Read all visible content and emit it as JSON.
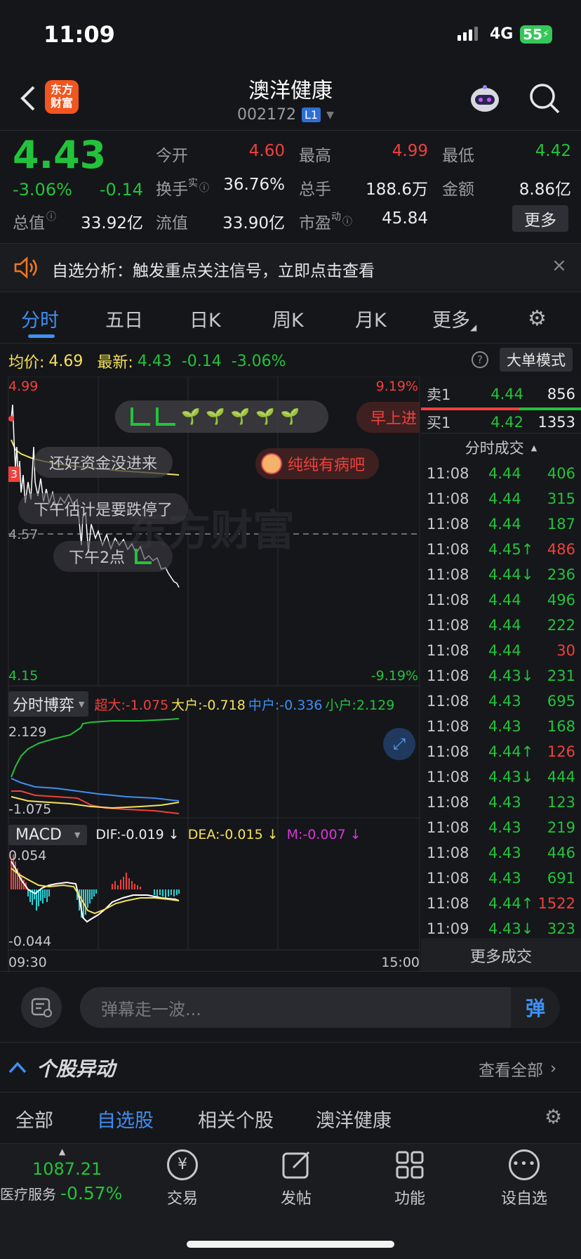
{
  "status": {
    "time": "11:09",
    "network": "4G",
    "battery": "55"
  },
  "header": {
    "title": "澳洋健康",
    "code": "002172",
    "level": "L1",
    "logo_lines": [
      "东方",
      "财富"
    ]
  },
  "quote": {
    "price": "4.43",
    "pct": "-3.06%",
    "chg": "-0.14",
    "open_label": "今开",
    "open": "4.60",
    "high_label": "最高",
    "high": "4.99",
    "low_label": "最低",
    "low": "4.42",
    "turn_label": "换手",
    "turn_sup": "实",
    "turn": "36.76%",
    "vol_label": "总手",
    "vol": "188.6万",
    "amt_label": "金额",
    "amt": "8.86亿",
    "mcap_label": "总值",
    "mcap": "33.92亿",
    "float_label": "流值",
    "float": "33.90亿",
    "pe_label": "市盈",
    "pe_sup": "动",
    "pe": "45.84",
    "more": "更多"
  },
  "notice": {
    "text": "自选分析：触发重点关注信号，立即点击查看"
  },
  "tabs": [
    "分时",
    "五日",
    "日K",
    "周K",
    "月K",
    "更多"
  ],
  "chart_info": {
    "avg_label": "均价:",
    "avg": "4.69",
    "last_label": "最新:",
    "last": "4.43",
    "chg": "-0.14",
    "pct": "-3.06%",
    "mode": "大单模式"
  },
  "chart_axes": {
    "ymax": "4.99",
    "ymid": "4.57",
    "ymin": "4.15",
    "pmax": "9.19%",
    "pmin": "-9.19%",
    "t_start": "09:30",
    "t_end": "15:00",
    "watermark": "东方财富"
  },
  "danmaku": [
    "还好资金没进来",
    "下午估计是要跌停了",
    "纯纯有病吧",
    "早上进",
    "下午2点"
  ],
  "game": {
    "label": "分时博弈",
    "items": [
      {
        "name": "超大",
        "value": "-1.075",
        "color": "#f0403c"
      },
      {
        "name": "大户",
        "value": "-0.718",
        "color": "#f3e15a"
      },
      {
        "name": "中户",
        "value": "-0.336",
        "color": "#3e8ff2"
      },
      {
        "name": "小户",
        "value": "2.129",
        "color": "#22c33a"
      }
    ],
    "ymax": "2.129",
    "ymin": "-1.075"
  },
  "macd": {
    "label": "MACD",
    "dif": "DIF:-0.019 ↓",
    "dea": "DEA:-0.015 ↓",
    "m": "M:-0.007 ↓",
    "ymax": "0.054",
    "ymin": "-0.044"
  },
  "orderbook": {
    "sell_label": "卖1",
    "sell_price": "4.44",
    "sell_vol": "856",
    "buy_label": "买1",
    "buy_price": "4.42",
    "buy_vol": "1353",
    "trades_title": "分时成交",
    "more_trades": "更多成交"
  },
  "trades": [
    {
      "t": "11:08",
      "p": "4.44",
      "v": "406",
      "vc": "green"
    },
    {
      "t": "11:08",
      "p": "4.44",
      "v": "315",
      "vc": "green"
    },
    {
      "t": "11:08",
      "p": "4.44",
      "v": "187",
      "vc": "green"
    },
    {
      "t": "11:08",
      "p": "4.45↑",
      "v": "486",
      "vc": "red"
    },
    {
      "t": "11:08",
      "p": "4.44↓",
      "v": "236",
      "vc": "green"
    },
    {
      "t": "11:08",
      "p": "4.44",
      "v": "496",
      "vc": "green"
    },
    {
      "t": "11:08",
      "p": "4.44",
      "v": "222",
      "vc": "green"
    },
    {
      "t": "11:08",
      "p": "4.44",
      "v": "30",
      "vc": "red"
    },
    {
      "t": "11:08",
      "p": "4.43↓",
      "v": "231",
      "vc": "green"
    },
    {
      "t": "11:08",
      "p": "4.43",
      "v": "695",
      "vc": "green"
    },
    {
      "t": "11:08",
      "p": "4.43",
      "v": "168",
      "vc": "green"
    },
    {
      "t": "11:08",
      "p": "4.44↑",
      "v": "126",
      "vc": "red"
    },
    {
      "t": "11:08",
      "p": "4.43↓",
      "v": "444",
      "vc": "green"
    },
    {
      "t": "11:08",
      "p": "4.43",
      "v": "123",
      "vc": "green"
    },
    {
      "t": "11:08",
      "p": "4.43",
      "v": "219",
      "vc": "green"
    },
    {
      "t": "11:08",
      "p": "4.43",
      "v": "446",
      "vc": "green"
    },
    {
      "t": "11:08",
      "p": "4.43",
      "v": "691",
      "vc": "green"
    },
    {
      "t": "11:08",
      "p": "4.44↑",
      "v": "1522",
      "vc": "red"
    },
    {
      "t": "11:09",
      "p": "4.43↓",
      "v": "323",
      "vc": "green"
    }
  ],
  "comment": {
    "placeholder": "弹幕走一波...",
    "send": "弹"
  },
  "movement": {
    "title": "个股异动",
    "view_all": "查看全部",
    "tabs": [
      "全部",
      "自选股",
      "相关个股",
      "澳洋健康"
    ]
  },
  "bottom": {
    "index_value": "1087.21",
    "index_name": "医疗服务",
    "index_pct": "-0.57%",
    "items": [
      "交易",
      "发帖",
      "功能",
      "设自选"
    ]
  }
}
